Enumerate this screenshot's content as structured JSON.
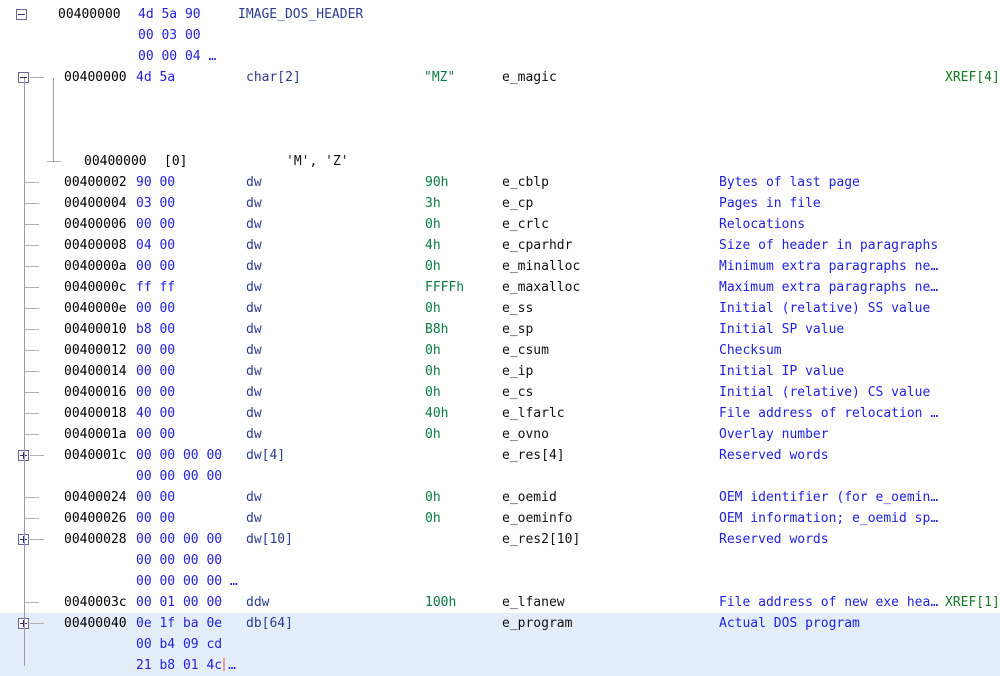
{
  "view": {
    "title": "Structure listing",
    "background": "#ffffff",
    "selection_color": "#e4eefb",
    "byte_color": "#2222dd",
    "value_color": "#0b7a42",
    "comment_color": "#2222dd",
    "xref_color": "#137a22",
    "type_color": "#2b3c8f"
  },
  "rows": [
    {
      "kind": "header",
      "indent": 0,
      "toggle": "minus",
      "address": "00400000",
      "bytes": "4d 5a 90",
      "type": "",
      "value": "",
      "name": "IMAGE_DOS_HEADER",
      "comment": "",
      "xref": ""
    },
    {
      "kind": "cont",
      "indent": 0,
      "toggle": "",
      "address": "",
      "bytes": "00 03 00",
      "type": "",
      "value": "",
      "name": "",
      "comment": "",
      "xref": ""
    },
    {
      "kind": "cont",
      "indent": 0,
      "toggle": "",
      "address": "",
      "bytes": "00 00 04",
      "ellipsis": true,
      "type": "",
      "value": "",
      "name": "",
      "comment": "",
      "xref": ""
    },
    {
      "kind": "field",
      "indent": 1,
      "toggle": "minus",
      "address": "00400000",
      "bytes": "4d 5a",
      "type": "char[2]",
      "value": "\"MZ\"",
      "name": "e_magic",
      "comment": "",
      "xref": "XREF[4]"
    },
    {
      "kind": "blank"
    },
    {
      "kind": "blank"
    },
    {
      "kind": "blank"
    },
    {
      "kind": "element",
      "indent": 2,
      "toggle": "",
      "address": "00400000",
      "index": "[0]",
      "chars": "'M', 'Z'"
    },
    {
      "kind": "field",
      "indent": 1,
      "toggle": "tick",
      "address": "00400002",
      "bytes": "90 00",
      "type": "dw",
      "value": "90h",
      "name": "e_cblp",
      "comment": "Bytes of last page",
      "xref": ""
    },
    {
      "kind": "field",
      "indent": 1,
      "toggle": "tick",
      "address": "00400004",
      "bytes": "03 00",
      "type": "dw",
      "value": "3h",
      "name": "e_cp",
      "comment": "Pages in file",
      "xref": ""
    },
    {
      "kind": "field",
      "indent": 1,
      "toggle": "tick",
      "address": "00400006",
      "bytes": "00 00",
      "type": "dw",
      "value": "0h",
      "name": "e_crlc",
      "comment": "Relocations",
      "xref": ""
    },
    {
      "kind": "field",
      "indent": 1,
      "toggle": "tick",
      "address": "00400008",
      "bytes": "04 00",
      "type": "dw",
      "value": "4h",
      "name": "e_cparhdr",
      "comment": "Size of header in paragraphs",
      "xref": ""
    },
    {
      "kind": "field",
      "indent": 1,
      "toggle": "tick",
      "address": "0040000a",
      "bytes": "00 00",
      "type": "dw",
      "value": "0h",
      "name": "e_minalloc",
      "comment": "Minimum extra paragraphs ne…",
      "xref": ""
    },
    {
      "kind": "field",
      "indent": 1,
      "toggle": "tick",
      "address": "0040000c",
      "bytes": "ff ff",
      "type": "dw",
      "value": "FFFFh",
      "name": "e_maxalloc",
      "comment": "Maximum extra paragraphs ne…",
      "xref": ""
    },
    {
      "kind": "field",
      "indent": 1,
      "toggle": "tick",
      "address": "0040000e",
      "bytes": "00 00",
      "type": "dw",
      "value": "0h",
      "name": "e_ss",
      "comment": "Initial (relative) SS value",
      "xref": ""
    },
    {
      "kind": "field",
      "indent": 1,
      "toggle": "tick",
      "address": "00400010",
      "bytes": "b8 00",
      "type": "dw",
      "value": "B8h",
      "name": "e_sp",
      "comment": "Initial SP value",
      "xref": ""
    },
    {
      "kind": "field",
      "indent": 1,
      "toggle": "tick",
      "address": "00400012",
      "bytes": "00 00",
      "type": "dw",
      "value": "0h",
      "name": "e_csum",
      "comment": "Checksum",
      "xref": ""
    },
    {
      "kind": "field",
      "indent": 1,
      "toggle": "tick",
      "address": "00400014",
      "bytes": "00 00",
      "type": "dw",
      "value": "0h",
      "name": "e_ip",
      "comment": "Initial IP value",
      "xref": ""
    },
    {
      "kind": "field",
      "indent": 1,
      "toggle": "tick",
      "address": "00400016",
      "bytes": "00 00",
      "type": "dw",
      "value": "0h",
      "name": "e_cs",
      "comment": "Initial (relative) CS value",
      "xref": ""
    },
    {
      "kind": "field",
      "indent": 1,
      "toggle": "tick",
      "address": "00400018",
      "bytes": "40 00",
      "type": "dw",
      "value": "40h",
      "name": "e_lfarlc",
      "comment": "File address of relocation …",
      "xref": ""
    },
    {
      "kind": "field",
      "indent": 1,
      "toggle": "tick",
      "address": "0040001a",
      "bytes": "00 00",
      "type": "dw",
      "value": "0h",
      "name": "e_ovno",
      "comment": "Overlay number",
      "xref": ""
    },
    {
      "kind": "field",
      "indent": 1,
      "toggle": "plus",
      "address": "0040001c",
      "bytes": "00 00 00 00",
      "type": "dw[4]",
      "value": "",
      "name": "e_res[4]",
      "comment": "Reserved words",
      "xref": ""
    },
    {
      "kind": "cont",
      "indent": 1,
      "toggle": "",
      "address": "",
      "bytes": "00 00 00 00",
      "type": "",
      "value": "",
      "name": "",
      "comment": "",
      "xref": ""
    },
    {
      "kind": "field",
      "indent": 1,
      "toggle": "tick",
      "address": "00400024",
      "bytes": "00 00",
      "type": "dw",
      "value": "0h",
      "name": "e_oemid",
      "comment": "OEM identifier (for e_oemin…",
      "xref": ""
    },
    {
      "kind": "field",
      "indent": 1,
      "toggle": "tick",
      "address": "00400026",
      "bytes": "00 00",
      "type": "dw",
      "value": "0h",
      "name": "e_oeminfo",
      "comment": "OEM information; e_oemid sp…",
      "xref": ""
    },
    {
      "kind": "field",
      "indent": 1,
      "toggle": "plus",
      "address": "00400028",
      "bytes": "00 00 00 00",
      "type": "dw[10]",
      "value": "",
      "name": "e_res2[10]",
      "comment": "Reserved words",
      "xref": ""
    },
    {
      "kind": "cont",
      "indent": 1,
      "toggle": "",
      "address": "",
      "bytes": "00 00 00 00",
      "type": "",
      "value": "",
      "name": "",
      "comment": "",
      "xref": ""
    },
    {
      "kind": "cont",
      "indent": 1,
      "toggle": "",
      "address": "",
      "bytes": "00 00 00 00",
      "ellipsis": true,
      "type": "",
      "value": "",
      "name": "",
      "comment": "",
      "xref": ""
    },
    {
      "kind": "field",
      "indent": 1,
      "toggle": "tick",
      "address": "0040003c",
      "bytes": "00 01 00 00",
      "type": "ddw",
      "value": "100h",
      "name": "e_lfanew",
      "comment": "File address of new exe hea…",
      "xref": "XREF[1]"
    },
    {
      "kind": "field",
      "indent": 1,
      "toggle": "plus",
      "selected": true,
      "address": "00400040",
      "bytes": "0e 1f ba 0e",
      "type": "db[64]",
      "value": "",
      "name": "e_program",
      "comment": "Actual DOS program",
      "xref": ""
    },
    {
      "kind": "cont",
      "indent": 1,
      "toggle": "",
      "selected": true,
      "address": "",
      "bytes": "00 b4 09 cd",
      "type": "",
      "value": "",
      "name": "",
      "comment": "",
      "xref": ""
    },
    {
      "kind": "cont",
      "indent": 1,
      "toggle": "",
      "selected": true,
      "caret": true,
      "address": "",
      "bytes": "21 b8 01 4c",
      "ellipsis": true,
      "type": "",
      "value": "",
      "name": "",
      "comment": "",
      "xref": ""
    }
  ]
}
